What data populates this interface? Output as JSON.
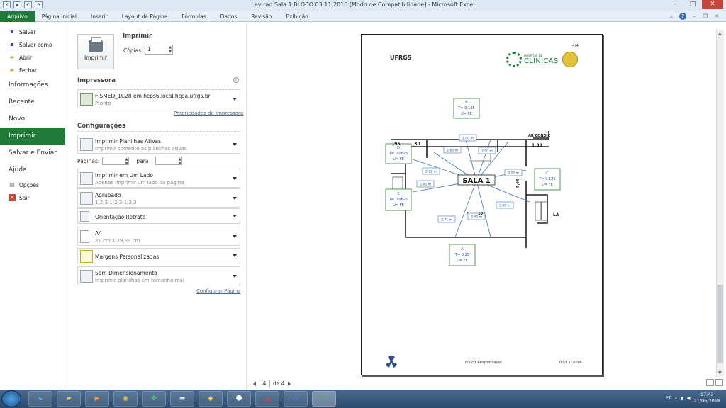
{
  "window": {
    "title": "Lev rad Sala 1 BLOCO 03.11.2016  [Modo de Compatibilidade]  -  Microsoft Excel"
  },
  "ribbon": {
    "tabs": [
      "Arquivo",
      "Página Inicial",
      "Inserir",
      "Layout da Página",
      "Fórmulas",
      "Dados",
      "Revisão",
      "Exibição"
    ]
  },
  "nav": {
    "save": "Salvar",
    "save_as": "Salvar como",
    "open": "Abrir",
    "close": "Fechar",
    "info": "Informações",
    "recent": "Recente",
    "new": "Novo",
    "print": "Imprimir",
    "save_send": "Salvar e Enviar",
    "help": "Ajuda",
    "options": "Opções",
    "exit": "Sair"
  },
  "print": {
    "title": "Imprimir",
    "button": "Imprimir",
    "copies_label": "Cópias:",
    "copies_value": "1"
  },
  "printer": {
    "section": "Impressora",
    "name": "FISMED_1C28 em hcps6.local.hcpa.ufrgs.br",
    "status": "Pronto",
    "properties_link": "Propriedades de Impressora"
  },
  "settings": {
    "section": "Configurações",
    "what": {
      "l1": "Imprimir Planilhas Ativas",
      "l2": "Imprimir somente as planilhas ativas"
    },
    "pages_label": "Páginas:",
    "to_label": "para",
    "sides": {
      "l1": "Imprimir em Um Lado",
      "l2": "Apenas imprimir um lado da página"
    },
    "collate": {
      "l1": "Agrupado",
      "l2": "1;2;3    1;2;3    1;2;3"
    },
    "orientation": "Orientação Retrato",
    "paper": {
      "l1": "A4",
      "l2": "21 cm x 29,69 cm"
    },
    "margins": "Margens Personalizadas",
    "scaling": {
      "l1": "Sem Dimensionamento",
      "l2": "Imprimir planilhas em tamanho real"
    },
    "page_setup_link": "Configurar Página"
  },
  "preview": {
    "page_number": "4/4",
    "ufrgs": "UFRGS",
    "hc_name": "CLÍNICAS",
    "hc_prefix": "HOSPITAL DE",
    "room": "SALA 1",
    "points": [
      {
        "id": "B",
        "t": "T= 0,125",
        "u": "U= FE"
      },
      {
        "id": "D",
        "t": "T= 0,0625",
        "u": "U= FE"
      },
      {
        "id": "C",
        "t": "T= 0,125",
        "u": "U= FE"
      },
      {
        "id": "E",
        "t": "T= 0,0625",
        "u": "U= FE"
      },
      {
        "id": "A",
        "t": "T= 0,25",
        "u": "U= FE"
      }
    ],
    "distances": [
      "2.00 m",
      "2.85 m",
      "2.00 m",
      "2.02 m",
      "2.00 m",
      "3.27 m",
      "3.00 m",
      "3.40 m",
      "3.71 m"
    ],
    "plan_labels": [
      ",95",
      ",30",
      "AR CONDIC",
      "1,39",
      "5,94",
      "LA",
      "7",
      "10"
    ],
    "footer_center": "Físico Responsável",
    "footer_right": "02/11/2016"
  },
  "pager": {
    "current": "4",
    "of": "de 4"
  },
  "taskbar": {
    "lang": "PT",
    "time": "17:43",
    "date": "21/06/2018"
  }
}
